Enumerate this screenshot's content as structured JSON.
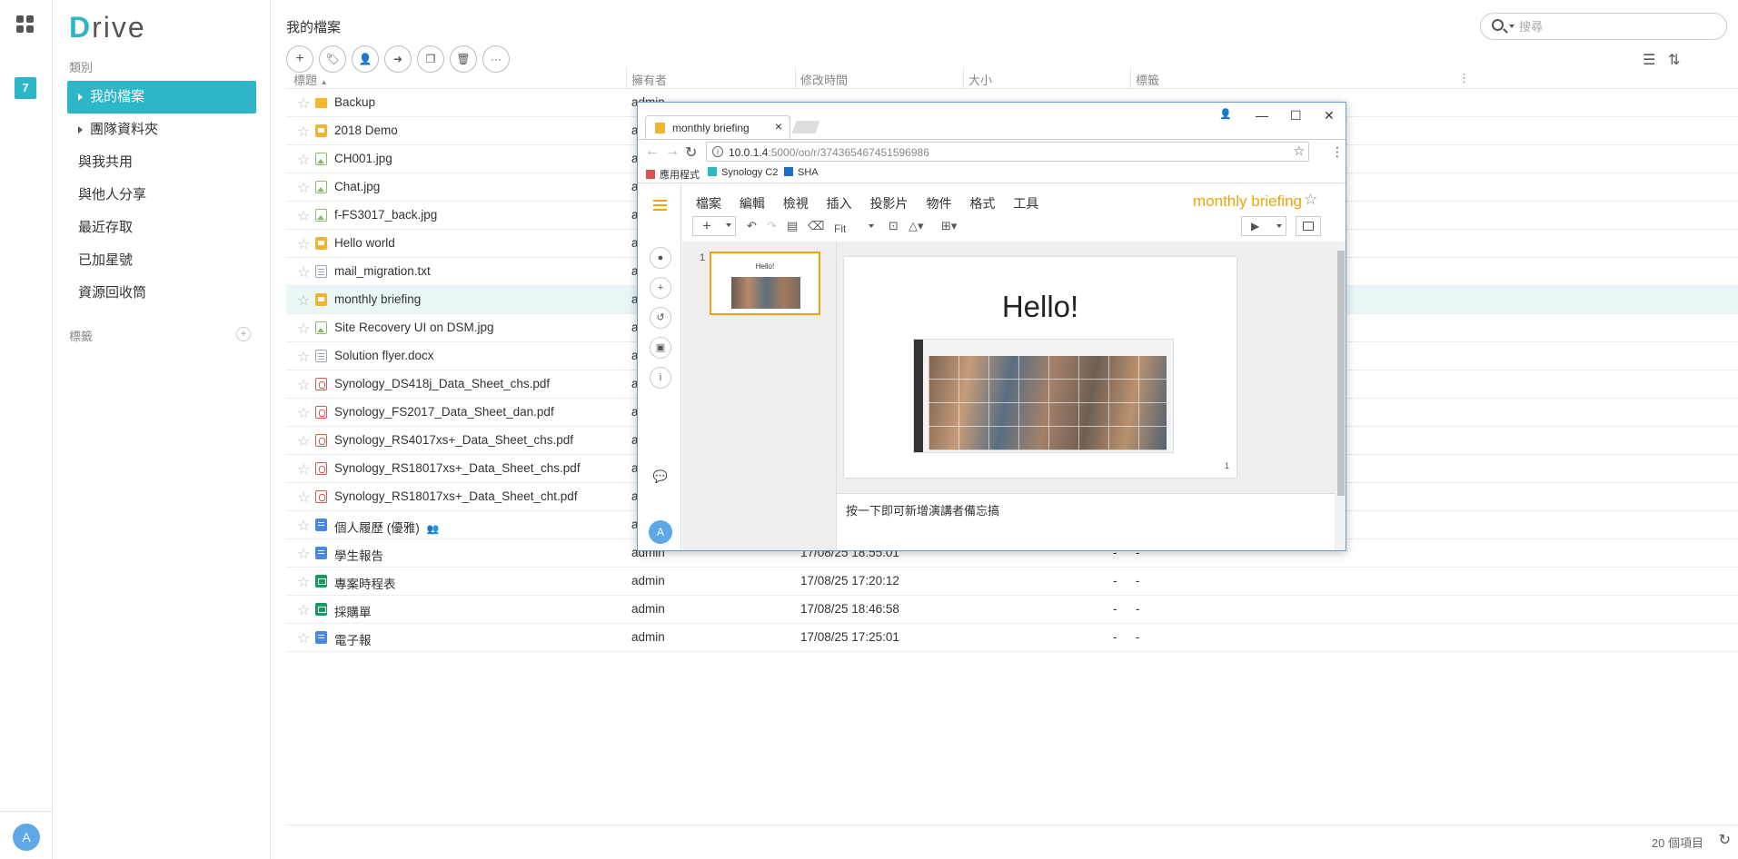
{
  "rail": {
    "calendar_day": "7",
    "avatar_letter": "A"
  },
  "sidebar": {
    "logo_first": "D",
    "logo_rest": "rive",
    "category_label": "類別",
    "items": [
      {
        "label": "我的檔案"
      },
      {
        "label": "團隊資料夾"
      },
      {
        "label": "與我共用"
      },
      {
        "label": "與他人分享"
      },
      {
        "label": "最近存取"
      },
      {
        "label": "已加星號"
      },
      {
        "label": "資源回收筒"
      }
    ],
    "tags_label": "標籤",
    "add_tag_symbol": "+"
  },
  "main": {
    "title": "我的檔案",
    "search": {
      "placeholder": "搜尋"
    },
    "toolbar": {
      "add": "+",
      "tag": "🏷",
      "share": "👤",
      "move": "➜",
      "copy": "❐",
      "delete": "🗑",
      "more": "···"
    },
    "view": {
      "list": "☰",
      "sort": "⇅"
    },
    "columns": {
      "title": "標題",
      "sort_arrow": "▲",
      "owner": "擁有者",
      "modified": "修改時間",
      "size": "大小",
      "tags": "標籤",
      "more": "⋮"
    },
    "rows": [
      {
        "name": "Backup",
        "type": "folder",
        "owner": "admin",
        "modified": "",
        "size": "",
        "tags": ""
      },
      {
        "name": "2018 Demo",
        "type": "slides",
        "owner": "admin",
        "modified": "",
        "size": "",
        "tags": ""
      },
      {
        "name": "CH001.jpg",
        "type": "image",
        "owner": "admin",
        "modified": "",
        "size": "",
        "tags": ""
      },
      {
        "name": "Chat.jpg",
        "type": "image",
        "owner": "admin",
        "modified": "",
        "size": "",
        "tags": ""
      },
      {
        "name": "f-FS3017_back.jpg",
        "type": "image",
        "owner": "admin",
        "modified": "",
        "size": "",
        "tags": ""
      },
      {
        "name": "Hello world",
        "type": "slides",
        "owner": "admin",
        "modified": "",
        "size": "",
        "tags": ""
      },
      {
        "name": "mail_migration.txt",
        "type": "text",
        "owner": "admin",
        "modified": "",
        "size": "",
        "tags": ""
      },
      {
        "name": "monthly briefing",
        "type": "slides",
        "owner": "admin",
        "modified": "",
        "size": "",
        "tags": ""
      },
      {
        "name": "Site Recovery UI on DSM.jpg",
        "type": "image",
        "owner": "admin",
        "modified": "",
        "size": "",
        "tags": ""
      },
      {
        "name": "Solution flyer.docx",
        "type": "text",
        "owner": "admin",
        "modified": "",
        "size": "",
        "tags": ""
      },
      {
        "name": "Synology_DS418j_Data_Sheet_chs.pdf",
        "type": "pdf",
        "owner": "admin",
        "modified": "",
        "size": "",
        "tags": ""
      },
      {
        "name": "Synology_FS2017_Data_Sheet_dan.pdf",
        "type": "pdf",
        "owner": "admin",
        "modified": "",
        "size": "",
        "tags": ""
      },
      {
        "name": "Synology_RS4017xs+_Data_Sheet_chs.pdf",
        "type": "pdf",
        "owner": "admin",
        "modified": "",
        "size": "",
        "tags": ""
      },
      {
        "name": "Synology_RS18017xs+_Data_Sheet_chs.pdf",
        "type": "pdf",
        "owner": "admin",
        "modified": "",
        "size": "",
        "tags": ""
      },
      {
        "name": "Synology_RS18017xs+_Data_Sheet_cht.pdf",
        "type": "pdf",
        "owner": "admin",
        "modified": "",
        "size": "",
        "tags": ""
      },
      {
        "name": "個人履歷 (優雅)",
        "type": "doc",
        "owner": "admin",
        "modified": "",
        "size": "",
        "tags": "",
        "shared": "👥"
      },
      {
        "name": "學生報告",
        "type": "doc",
        "owner": "admin",
        "modified": "17/08/25 18:55:01",
        "size": "-",
        "tags": "-"
      },
      {
        "name": "專案時程表",
        "type": "sheet",
        "owner": "admin",
        "modified": "17/08/25 17:20:12",
        "size": "-",
        "tags": "-"
      },
      {
        "name": "採購單",
        "type": "sheet",
        "owner": "admin",
        "modified": "17/08/25 18:46:58",
        "size": "-",
        "tags": "-"
      },
      {
        "name": "電子報",
        "type": "doc",
        "owner": "admin",
        "modified": "17/08/25 17:25:01",
        "size": "-",
        "tags": "-"
      }
    ],
    "footer": {
      "count": "20 個項目",
      "refresh": "↻"
    }
  },
  "browser": {
    "tab_title": "monthly briefing",
    "tab_close": "×",
    "controls": {
      "profile": "👤",
      "minimize": "—",
      "maximize": "☐",
      "close": "✕"
    },
    "nav": {
      "back": "←",
      "forward": "→",
      "reload": "↻"
    },
    "url_host": "10.0.1.4",
    "url_path": ":5000/oo/r/374365467451596986",
    "bookmarks": [
      {
        "label": "應用程式",
        "color": "#d9534f"
      },
      {
        "label": "Synology C2",
        "color": "#2db6c7"
      },
      {
        "label": "SHA",
        "color": "#1e6ec8"
      }
    ],
    "office": {
      "menu": [
        "檔案",
        "編輯",
        "檢視",
        "插入",
        "投影片",
        "物件",
        "格式",
        "工具"
      ],
      "doc_title": "monthly briefing",
      "zoom": "Fit",
      "slide_number": "1",
      "slide_title": "Hello!",
      "notes_placeholder": "按一下即可新增演講者備忘搞",
      "avatar_letter": "A",
      "accent": "#f0a30a"
    }
  }
}
